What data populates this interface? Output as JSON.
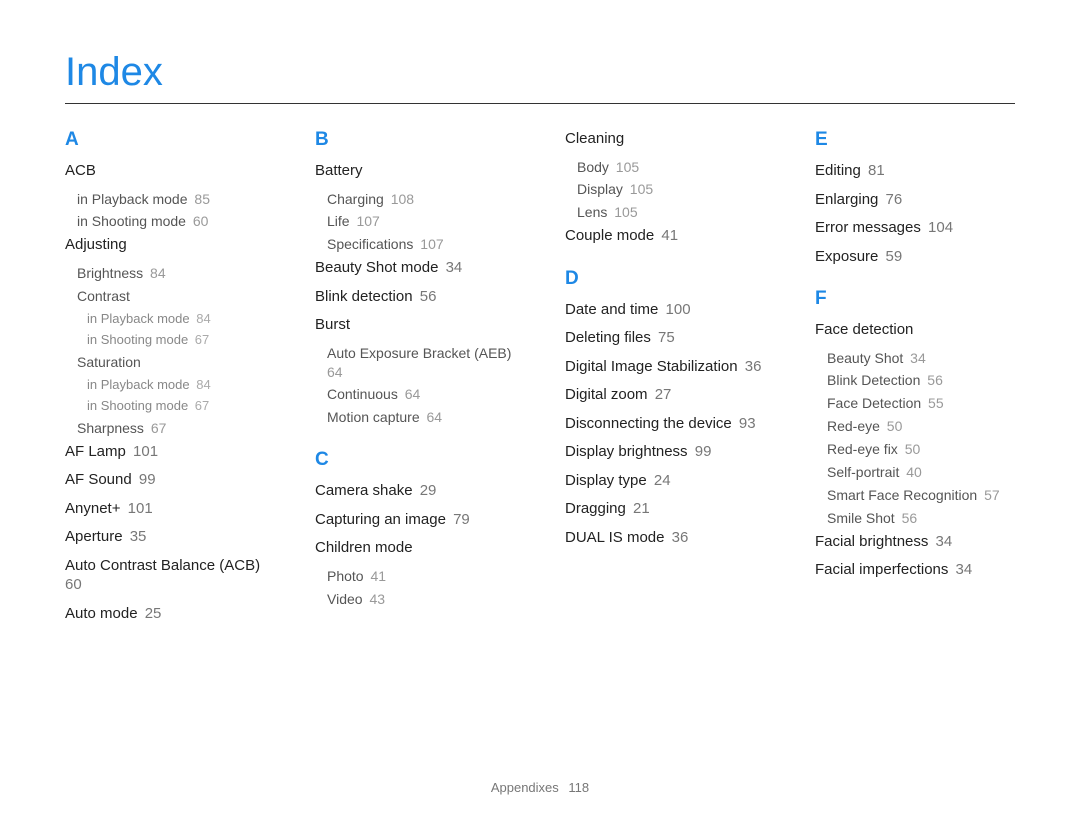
{
  "title": "Index",
  "footer": {
    "label": "Appendixes",
    "page": "118"
  },
  "columns": [
    [
      {
        "type": "letter",
        "text": "A"
      },
      {
        "type": "entry",
        "text": "ACB"
      },
      {
        "type": "sub",
        "text": "in Playback mode",
        "page": "85"
      },
      {
        "type": "sub",
        "text": "in Shooting mode",
        "page": "60"
      },
      {
        "type": "entry",
        "text": "Adjusting"
      },
      {
        "type": "sub",
        "text": "Brightness",
        "page": "84"
      },
      {
        "type": "sub",
        "text": "Contrast"
      },
      {
        "type": "subsub",
        "text": "in Playback mode",
        "page": "84"
      },
      {
        "type": "subsub",
        "text": "in Shooting mode",
        "page": "67"
      },
      {
        "type": "sub",
        "text": "Saturation"
      },
      {
        "type": "subsub",
        "text": "in Playback mode",
        "page": "84"
      },
      {
        "type": "subsub",
        "text": "in Shooting mode",
        "page": "67"
      },
      {
        "type": "sub",
        "text": "Sharpness",
        "page": "67"
      },
      {
        "type": "entry",
        "text": "AF Lamp",
        "page": "101"
      },
      {
        "type": "entry",
        "text": "AF Sound",
        "page": "99"
      },
      {
        "type": "entry",
        "text": "Anynet+",
        "page": "101"
      },
      {
        "type": "entry",
        "text": "Aperture",
        "page": "35"
      },
      {
        "type": "entry",
        "text": "Auto Contrast Balance (ACB)",
        "page": "60"
      },
      {
        "type": "entry",
        "text": "Auto mode",
        "page": "25"
      }
    ],
    [
      {
        "type": "letter",
        "text": "B"
      },
      {
        "type": "entry",
        "text": "Battery"
      },
      {
        "type": "sub",
        "text": "Charging",
        "page": "108"
      },
      {
        "type": "sub",
        "text": "Life",
        "page": "107"
      },
      {
        "type": "sub",
        "text": "Specifications",
        "page": "107"
      },
      {
        "type": "entry",
        "text": "Beauty Shot mode",
        "page": "34"
      },
      {
        "type": "entry",
        "text": "Blink detection",
        "page": "56"
      },
      {
        "type": "entry",
        "text": "Burst"
      },
      {
        "type": "sub",
        "text": "Auto Exposure Bracket (AEB)",
        "page": "64"
      },
      {
        "type": "sub",
        "text": "Continuous",
        "page": "64"
      },
      {
        "type": "sub",
        "text": "Motion capture",
        "page": "64"
      },
      {
        "type": "letter",
        "text": "C"
      },
      {
        "type": "entry",
        "text": "Camera shake",
        "page": "29"
      },
      {
        "type": "entry",
        "text": "Capturing an image",
        "page": "79"
      },
      {
        "type": "entry",
        "text": "Children mode"
      },
      {
        "type": "sub",
        "text": "Photo",
        "page": "41"
      },
      {
        "type": "sub",
        "text": "Video",
        "page": "43"
      }
    ],
    [
      {
        "type": "entry",
        "text": "Cleaning"
      },
      {
        "type": "sub",
        "text": "Body",
        "page": "105"
      },
      {
        "type": "sub",
        "text": "Display",
        "page": "105"
      },
      {
        "type": "sub",
        "text": "Lens",
        "page": "105"
      },
      {
        "type": "entry",
        "text": "Couple mode",
        "page": "41"
      },
      {
        "type": "letter",
        "text": "D"
      },
      {
        "type": "entry",
        "text": "Date and time",
        "page": "100"
      },
      {
        "type": "entry",
        "text": "Deleting files",
        "page": "75"
      },
      {
        "type": "entry",
        "text": "Digital Image Stabilization",
        "page": "36"
      },
      {
        "type": "entry",
        "text": "Digital zoom",
        "page": "27"
      },
      {
        "type": "entry",
        "text": "Disconnecting the device",
        "page": "93"
      },
      {
        "type": "entry",
        "text": "Display brightness",
        "page": "99"
      },
      {
        "type": "entry",
        "text": "Display type",
        "page": "24"
      },
      {
        "type": "entry",
        "text": "Dragging",
        "page": "21"
      },
      {
        "type": "entry",
        "text": "DUAL IS mode",
        "page": "36"
      }
    ],
    [
      {
        "type": "letter",
        "text": "E"
      },
      {
        "type": "entry",
        "text": "Editing",
        "page": "81"
      },
      {
        "type": "entry",
        "text": "Enlarging",
        "page": "76"
      },
      {
        "type": "entry",
        "text": "Error messages",
        "page": "104"
      },
      {
        "type": "entry",
        "text": "Exposure",
        "page": "59"
      },
      {
        "type": "letter",
        "text": "F"
      },
      {
        "type": "entry",
        "text": "Face detection"
      },
      {
        "type": "sub",
        "text": "Beauty Shot",
        "page": "34"
      },
      {
        "type": "sub",
        "text": "Blink Detection",
        "page": "56"
      },
      {
        "type": "sub",
        "text": "Face Detection",
        "page": "55"
      },
      {
        "type": "sub",
        "text": "Red-eye",
        "page": "50"
      },
      {
        "type": "sub",
        "text": "Red-eye fix",
        "page": "50"
      },
      {
        "type": "sub",
        "text": "Self-portrait",
        "page": "40"
      },
      {
        "type": "sub",
        "text": "Smart Face Recognition",
        "page": "57"
      },
      {
        "type": "sub",
        "text": "Smile Shot",
        "page": "56"
      },
      {
        "type": "entry",
        "text": "Facial brightness",
        "page": "34"
      },
      {
        "type": "entry",
        "text": "Facial imperfections",
        "page": "34"
      }
    ]
  ]
}
